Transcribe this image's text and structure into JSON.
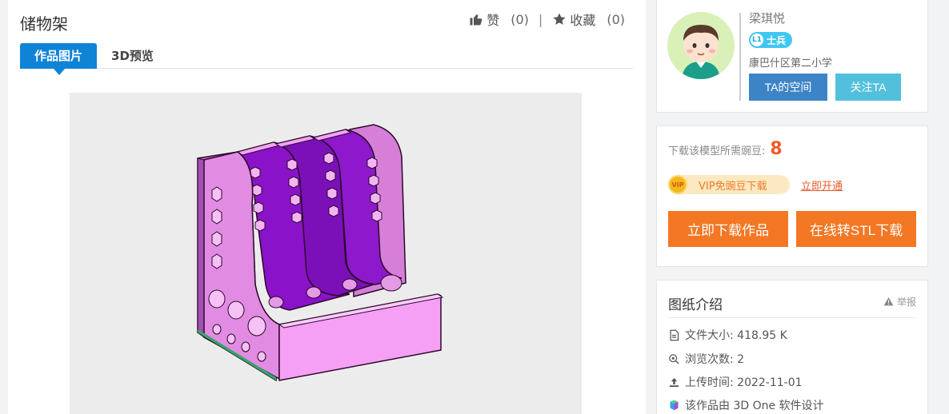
{
  "work": {
    "title": "储物架",
    "like_label": "赞",
    "like_count": "(0)",
    "separator": "|",
    "favorite_label": "收藏",
    "favorite_count": "(0)"
  },
  "tabs": [
    {
      "label": "作品图片",
      "active": true
    },
    {
      "label": "3D预览",
      "active": false
    }
  ],
  "author": {
    "name": "梁琪悦",
    "level_icon": "L1",
    "rank": "士兵",
    "school": "康巴什区第二小学",
    "space_button": "TA的空间",
    "follow_button": "关注TA"
  },
  "download": {
    "price_label": "下载该模型所需豌豆:",
    "price_value": "8",
    "vip_icon_text": "VIP",
    "vip_text": "VIP免豌豆下载",
    "open_vip": "立即开通",
    "download_button": "立即下载作品",
    "stl_button": "在线转STL下载"
  },
  "intro": {
    "title": "图纸介绍",
    "report": "举报",
    "file_size": "文件大小: 418.95 K",
    "views": "浏览次数: 2",
    "upload_time": "上传时间: 2022-11-01",
    "software": "该作品由 3D One 软件设计"
  },
  "colors": {
    "primary_blue": "#0f83d6",
    "download_orange": "#f47724",
    "price_red": "#f15a2a",
    "model_pink": "#f08ff0",
    "model_purple": "#8a12c8"
  }
}
